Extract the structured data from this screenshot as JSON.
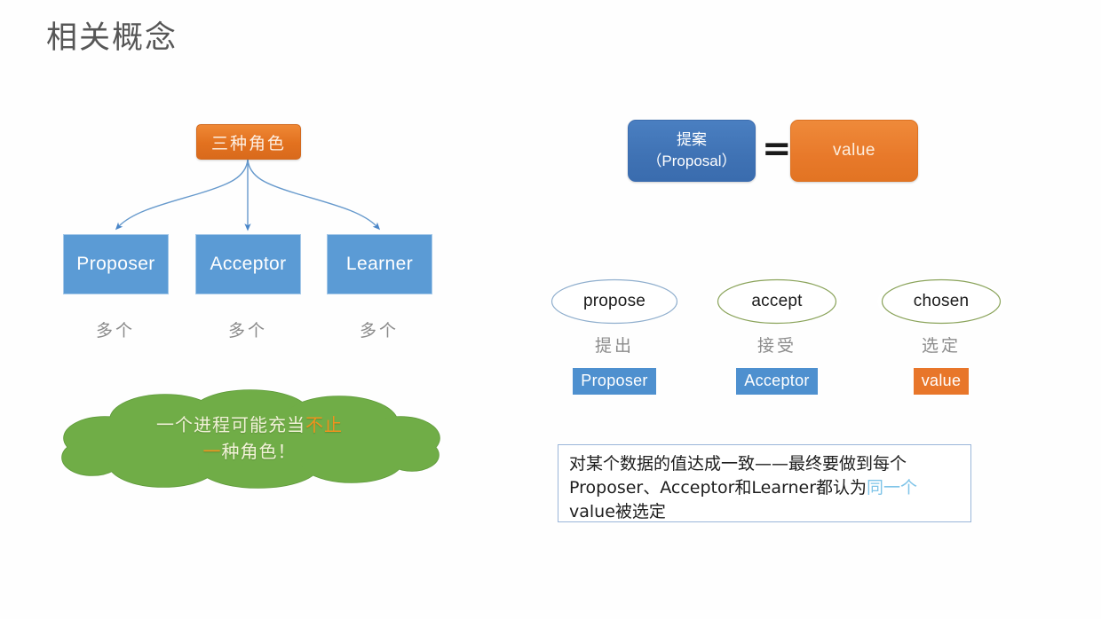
{
  "slide": {
    "title": "相关概念",
    "background": "#ffffff"
  },
  "left_diagram": {
    "root_box": {
      "label": "三种角色",
      "fill": "#e2711f",
      "text_color": "#fdf0e4"
    },
    "roles": [
      {
        "label": "Proposer",
        "count_label": "多个",
        "fill": "#5b9bd5"
      },
      {
        "label": "Acceptor",
        "count_label": "多个",
        "fill": "#5b9bd5"
      },
      {
        "label": "Learner",
        "count_label": "多个",
        "fill": "#5b9bd5"
      }
    ],
    "arrow_color": "#5b9bd5",
    "cloud": {
      "fill": "#70ad47",
      "stroke": "#4f8a2f",
      "line1_plain": "一个进程可能充当",
      "line1_highlight": "不止",
      "line2_highlight": "一",
      "line2_plain": "种角色！",
      "highlight_color": "#f0921e",
      "text_color": "#f2f2d8"
    }
  },
  "right_diagram": {
    "equation": {
      "left_box_line1": "提案",
      "left_box_line2": "（Proposal）",
      "left_box_fill": "#3f72b4",
      "operator": "=",
      "right_box_label": "value",
      "right_box_fill": "#e8792a"
    },
    "terms": [
      {
        "english": "propose",
        "chinese": "提出",
        "tag": "Proposer",
        "ellipse_stroke": "#8faecd",
        "tag_style": "tag-blue"
      },
      {
        "english": "accept",
        "chinese": "接受",
        "tag": "Acceptor",
        "ellipse_stroke": "#8aa35a",
        "tag_style": "tag-blue"
      },
      {
        "english": "chosen",
        "chinese": "选定",
        "tag": "value",
        "ellipse_stroke": "#8aa35a",
        "tag_style": "tag-orange"
      }
    ],
    "note": {
      "part1": "对某个数据的值达成一致——最终要做到每个Proposer、Acceptor和Learner都认为",
      "highlight": "同一个",
      "part2": "value被选定",
      "border_color": "#9ab6d9",
      "highlight_color": "#7fc4e8"
    }
  }
}
